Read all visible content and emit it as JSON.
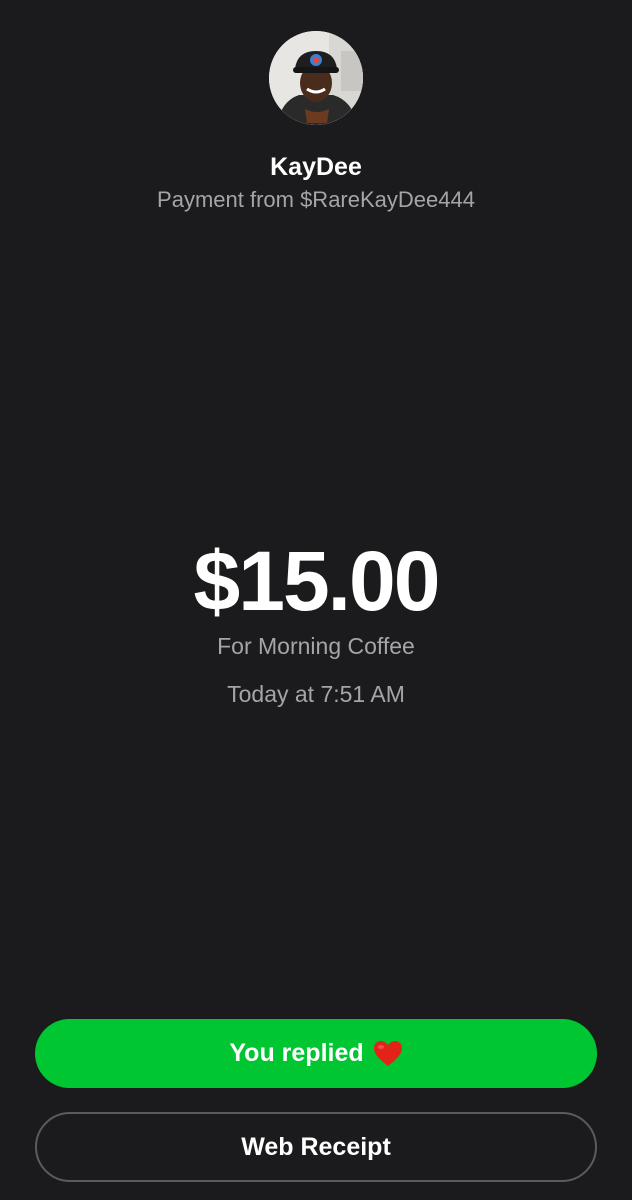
{
  "payment": {
    "sender_name": "KayDee",
    "subtitle": "Payment from $RareKayDee444",
    "amount": "$15.00",
    "note": "For Morning Coffee",
    "timestamp": "Today at 7:51 AM"
  },
  "actions": {
    "replied_label": "You replied",
    "replied_emoji_icon": "red-heart-icon",
    "web_receipt_label": "Web Receipt"
  },
  "colors": {
    "background": "#1b1b1d",
    "primary_green": "#00c632",
    "secondary_text": "#a5a5a8",
    "outline": "#5b5b5e",
    "heart": "#e2231a"
  }
}
